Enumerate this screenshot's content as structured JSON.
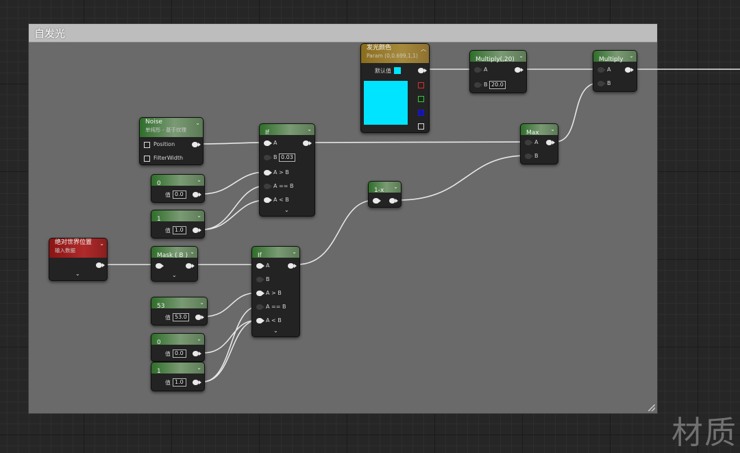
{
  "comment": {
    "title": "自发光"
  },
  "nodes": {
    "emissive_param": {
      "title": "发光颜色",
      "subtitle": "Param (0,0.699,1,1)",
      "default_label": "默认值",
      "color": "#00e4ff"
    },
    "multiply_20": {
      "title": "Multiply(,20)",
      "pin_a": "A",
      "pin_b": "B",
      "b_value": "20.0"
    },
    "multiply_out": {
      "title": "Multiply",
      "pin_a": "A",
      "pin_b": "B"
    },
    "noise": {
      "title": "Noise",
      "subtitle": "单纯形 - 基于纹理",
      "pin_position": "Position",
      "pin_filterwidth": "FilterWidth"
    },
    "if_top": {
      "title": "If",
      "pin_a": "A",
      "pin_b": "B",
      "b_value": "0.03",
      "pin_gt": "A > B",
      "pin_eq": "A == B",
      "pin_lt": "A < B"
    },
    "max": {
      "title": "Max",
      "pin_a": "A",
      "pin_b": "B"
    },
    "one_minus": {
      "title": "1-x"
    },
    "const_0_top": {
      "title": "0",
      "label": "值",
      "value": "0.0"
    },
    "const_1_top": {
      "title": "1",
      "label": "值",
      "value": "1.0"
    },
    "world_pos": {
      "title": "绝对世界位置",
      "subtitle": "输入数据"
    },
    "mask_b": {
      "title": "Mask ( B )"
    },
    "if_bottom": {
      "title": "If",
      "pin_a": "A",
      "pin_b": "B",
      "pin_gt": "A > B",
      "pin_eq": "A == B",
      "pin_lt": "A < B"
    },
    "const_53": {
      "title": "53",
      "label": "值",
      "value": "53.0"
    },
    "const_0_bottom": {
      "title": "0",
      "label": "值",
      "value": "0.0"
    },
    "const_1_bottom": {
      "title": "1",
      "label": "值",
      "value": "1.0"
    }
  },
  "watermark": "材质"
}
